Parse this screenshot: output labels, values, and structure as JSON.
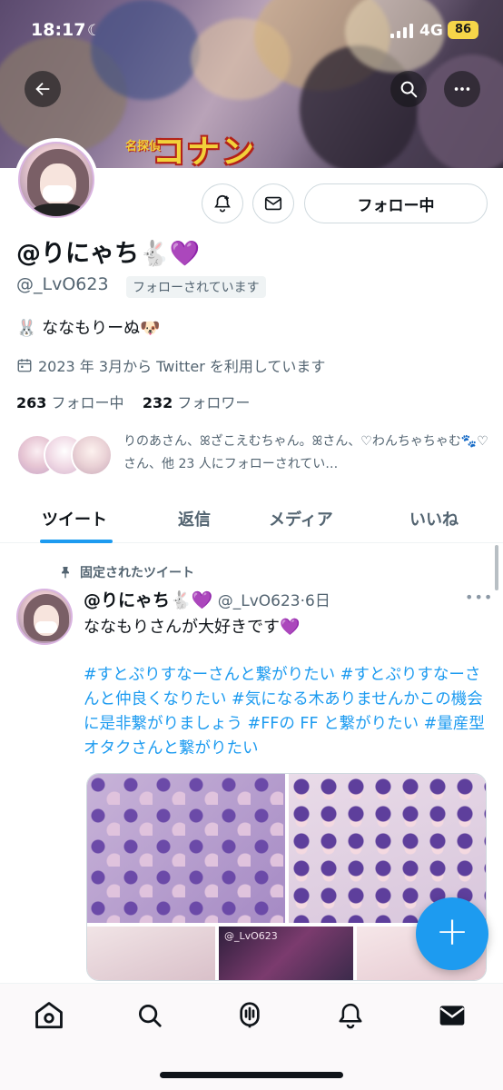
{
  "status_bar": {
    "time": "18:17",
    "network": "4G",
    "battery": "86"
  },
  "banner": {
    "logo_sub": "名探偵",
    "logo_text": "コナン"
  },
  "profile": {
    "follow_button": "フォロー中",
    "display_name": "@りにゃち🐇💜",
    "handle": "@_LvO623",
    "follows_you": "フォローされています",
    "bio": "🐰 ななもりーぬ🐶",
    "joined": "2023 年 3月から Twitter を利用しています",
    "following_count": "263",
    "following_label": "フォロー中",
    "followers_count": "232",
    "followers_label": "フォロワー",
    "mutuals_text": "りのあさん、ꕤざこえむちゃん。ꕤさん、♡わんちゃちゃむ🐾♡さん、他 23 人にフォローされてい…"
  },
  "tabs": [
    {
      "label": "ツイート"
    },
    {
      "label": "返信"
    },
    {
      "label": "メディア"
    },
    {
      "label": "いいね"
    }
  ],
  "tweet": {
    "pinned_label": "固定されたツイート",
    "name": "@りにゃち🐇💜",
    "handle": "@_LvO623",
    "time": "6日",
    "more": "•••",
    "text": "ななもりさんが大好きです💜",
    "hashtags": "#すとぷりすなーさんと繋がりたい #すとぷりすなーさんと仲良くなりたい #気になる木ありませんかこの機会に是非繋がりましょう #FFの FF と繋がりたい #量産型オタクさんと繋がりたい",
    "media_caption": "@_LvO623"
  },
  "fab_label": "+",
  "icons": {
    "back": "back-arrow-icon",
    "search": "search-icon",
    "more": "more-icon",
    "notify": "bell-plus-icon",
    "message": "mail-icon",
    "calendar": "calendar-icon",
    "pin": "pin-icon",
    "nav": [
      "home-icon",
      "search-icon",
      "spaces-icon",
      "bell-icon",
      "mail-icon"
    ]
  },
  "colors": {
    "accent": "#1d9bf0",
    "text": "#0f1419",
    "secondary": "#536471"
  }
}
